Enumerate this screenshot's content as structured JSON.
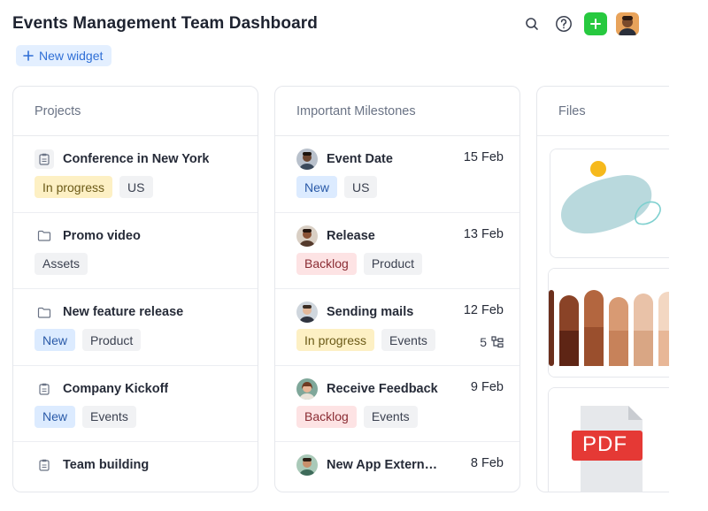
{
  "header": {
    "title": "Events Management Team Dashboard",
    "new_widget_label": "New widget"
  },
  "projects": {
    "title": "Projects",
    "items": [
      {
        "title": "Conference in New York",
        "icon": "clipboard-icon",
        "tags": [
          "In progress",
          "US"
        ]
      },
      {
        "title": "Promo video",
        "icon": "folder-icon",
        "tags": [
          "Assets"
        ]
      },
      {
        "title": "New feature release",
        "icon": "folder-icon",
        "tags": [
          "New",
          "Product"
        ]
      },
      {
        "title": "Company Kickoff",
        "icon": "clipboard-icon",
        "tags": [
          "New",
          "Events"
        ]
      },
      {
        "title": "Team building",
        "icon": "clipboard-icon",
        "tags": []
      }
    ]
  },
  "milestones": {
    "title": "Important Milestones",
    "items": [
      {
        "title": "Event Date",
        "date": "15 Feb",
        "tags": [
          "New",
          "US"
        ]
      },
      {
        "title": "Release",
        "date": "13 Feb",
        "tags": [
          "Backlog",
          "Product"
        ]
      },
      {
        "title": "Sending mails",
        "date": "12 Feb",
        "tags": [
          "In progress",
          "Events"
        ],
        "subtasks": "5"
      },
      {
        "title": "Receive Feedback",
        "date": "9 Feb",
        "tags": [
          "Backlog",
          "Events"
        ]
      },
      {
        "title": "New App Extern…",
        "date": "8 Feb",
        "tags": []
      }
    ]
  },
  "files": {
    "title": "Files",
    "pdf_label": "PDF"
  },
  "colors": {
    "accent": "#2f6fd6",
    "green": "#27c93f",
    "in_progress": "#fdf0c4",
    "new": "#dcebff",
    "backlog": "#fde3e4"
  }
}
